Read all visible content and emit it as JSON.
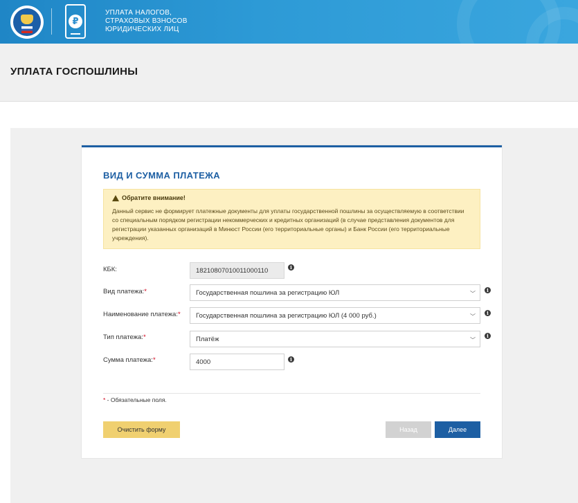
{
  "header": {
    "title_lines": [
      "УПЛАТА НАЛОГОВ,",
      "СТРАХОВЫХ ВЗНОСОВ",
      "ЮРИДИЧЕСКИХ ЛИЦ"
    ],
    "ruble_symbol": "₽",
    "emblem_icon": "fns-emblem-icon",
    "phone_icon": "phone-ruble-icon",
    "colors": {
      "header_bg": "#2d9ad6",
      "accent": "#1d5fa3"
    }
  },
  "page": {
    "title": "УПЛАТА ГОСПОШЛИНЫ"
  },
  "card": {
    "title": "ВИД И СУММА ПЛАТЕЖА",
    "notice": {
      "heading": "Обратите внимание!",
      "text": "Данный сервис не формирует платежные документы для уплаты государственной пошлины за осуществляемую в соответствии со специальным порядком регистрации некоммерческих и кредитных организаций (в случае представления документов для регистрации указанных организаций в Минюст России (его территориальные органы) и Банк России (его территориальные учреждения).",
      "icon": "warning-icon"
    },
    "fields": {
      "kbk": {
        "label": "КБК:",
        "value": "18210807010011000110"
      },
      "payment_type": {
        "label": "Вид платежа:",
        "required": "*",
        "value": "Государственная пошлина за регистрацию ЮЛ"
      },
      "payment_name": {
        "label": "Наименование платежа:",
        "required": "*",
        "value": "Государственная пошлина за регистрацию ЮЛ (4 000 руб.)"
      },
      "payment_kind": {
        "label": "Тип платежа:",
        "required": "*",
        "value": "Платёж"
      },
      "amount": {
        "label": "Сумма платежа:",
        "required": "*",
        "value": "4000"
      }
    },
    "required_note": {
      "star": "*",
      "text": " - Обязательные поля."
    },
    "buttons": {
      "clear": "Очистить форму",
      "back": "Назад",
      "next": "Далее"
    }
  }
}
